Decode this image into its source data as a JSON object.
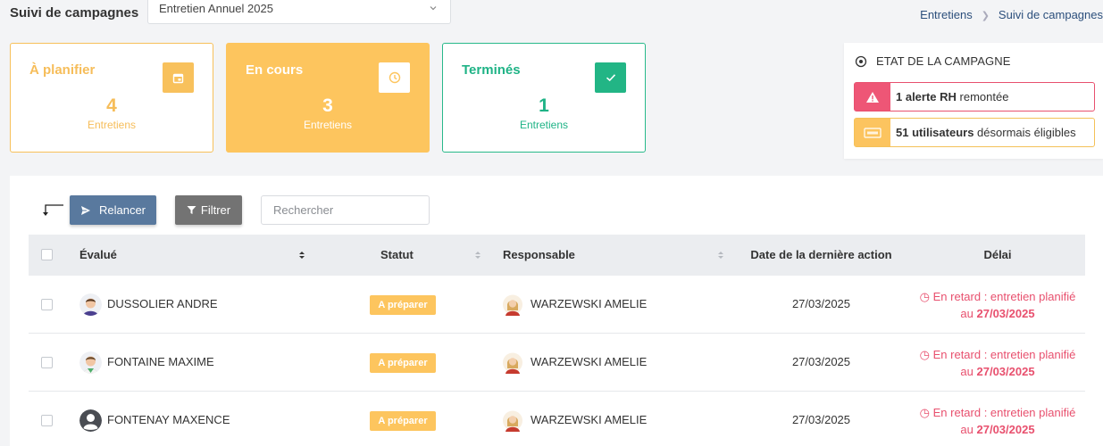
{
  "header": {
    "page_title": "Suivi de campagnes",
    "campaign_select": "Entretien Annuel 2025",
    "breadcrumb": [
      "Entretiens",
      "Suivi de campagnes"
    ]
  },
  "cards": {
    "plan": {
      "label": "À planifier",
      "count": "4",
      "sub": "Entretiens",
      "icon": "calendar-icon"
    },
    "cours": {
      "label": "En cours",
      "count": "3",
      "sub": "Entretiens",
      "icon": "clock-icon"
    },
    "term": {
      "label": "Terminés",
      "count": "1",
      "sub": "Entretiens",
      "icon": "check-icon"
    }
  },
  "state": {
    "title": "ETAT DE LA CAMPAGNE",
    "alert_rh_bold": "1 alerte RH",
    "alert_rh_rest": " remontée",
    "users_bold": "51 utilisateurs",
    "users_rest": " désormais éligibles"
  },
  "toolbar": {
    "relancer": "Relancer",
    "filtrer": "Filtrer",
    "search_placeholder": "Rechercher"
  },
  "table": {
    "columns": [
      "Évalué",
      "Statut",
      "Responsable",
      "Date de la dernière action",
      "Délai"
    ],
    "rows": [
      {
        "evalue": "DUSSOLIER ANDRE",
        "statut": "A préparer",
        "responsable": "WARZEWSKI AMELIE",
        "date": "27/03/2025",
        "delai_text": "En retard : entretien planifié au ",
        "delai_date": "27/03/2025"
      },
      {
        "evalue": "FONTAINE MAXIME",
        "statut": "A préparer",
        "responsable": "WARZEWSKI AMELIE",
        "date": "27/03/2025",
        "delai_text": "En retard : entretien planifié au ",
        "delai_date": "27/03/2025"
      },
      {
        "evalue": "FONTENAY MAXENCE",
        "statut": "A préparer",
        "responsable": "WARZEWSKI AMELIE",
        "date": "27/03/2025",
        "delai_text": "En retard : entretien planifié au ",
        "delai_date": "27/03/2025"
      }
    ]
  },
  "colors": {
    "accent_yellow": "#fdc55e",
    "accent_green": "#22b585",
    "accent_red": "#e8506e",
    "button_blue": "#59799e"
  }
}
